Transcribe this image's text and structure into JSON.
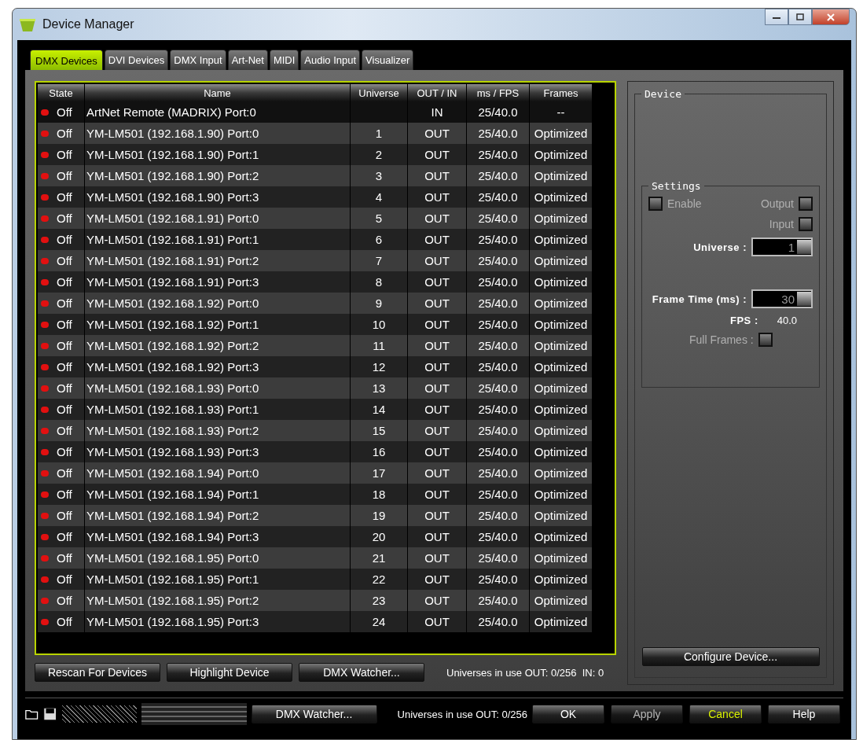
{
  "window": {
    "title": "Device Manager"
  },
  "tabs": [
    {
      "label": "DMX Devices",
      "selected": true
    },
    {
      "label": "DVI Devices",
      "selected": false
    },
    {
      "label": "DMX Input",
      "selected": false
    },
    {
      "label": "Art-Net",
      "selected": false
    },
    {
      "label": "MIDI",
      "selected": false
    },
    {
      "label": "Audio Input",
      "selected": false
    },
    {
      "label": "Visualizer",
      "selected": false
    }
  ],
  "table": {
    "columns": [
      "State",
      "Name",
      "Universe",
      "OUT / IN",
      "ms / FPS",
      "Frames"
    ],
    "rows": [
      {
        "state": "Off",
        "name": "ArtNet Remote (MADRIX) Port:0",
        "universe": "",
        "direction": "IN",
        "rate": "25/40.0",
        "frames": "--"
      },
      {
        "state": "Off",
        "name": "YM-LM501 (192.168.1.90) Port:0",
        "universe": "1",
        "direction": "OUT",
        "rate": "25/40.0",
        "frames": "Optimized"
      },
      {
        "state": "Off",
        "name": "YM-LM501 (192.168.1.90) Port:1",
        "universe": "2",
        "direction": "OUT",
        "rate": "25/40.0",
        "frames": "Optimized"
      },
      {
        "state": "Off",
        "name": "YM-LM501 (192.168.1.90) Port:2",
        "universe": "3",
        "direction": "OUT",
        "rate": "25/40.0",
        "frames": "Optimized"
      },
      {
        "state": "Off",
        "name": "YM-LM501 (192.168.1.90) Port:3",
        "universe": "4",
        "direction": "OUT",
        "rate": "25/40.0",
        "frames": "Optimized"
      },
      {
        "state": "Off",
        "name": "YM-LM501 (192.168.1.91) Port:0",
        "universe": "5",
        "direction": "OUT",
        "rate": "25/40.0",
        "frames": "Optimized"
      },
      {
        "state": "Off",
        "name": "YM-LM501 (192.168.1.91) Port:1",
        "universe": "6",
        "direction": "OUT",
        "rate": "25/40.0",
        "frames": "Optimized"
      },
      {
        "state": "Off",
        "name": "YM-LM501 (192.168.1.91) Port:2",
        "universe": "7",
        "direction": "OUT",
        "rate": "25/40.0",
        "frames": "Optimized"
      },
      {
        "state": "Off",
        "name": "YM-LM501 (192.168.1.91) Port:3",
        "universe": "8",
        "direction": "OUT",
        "rate": "25/40.0",
        "frames": "Optimized"
      },
      {
        "state": "Off",
        "name": "YM-LM501 (192.168.1.92) Port:0",
        "universe": "9",
        "direction": "OUT",
        "rate": "25/40.0",
        "frames": "Optimized"
      },
      {
        "state": "Off",
        "name": "YM-LM501 (192.168.1.92) Port:1",
        "universe": "10",
        "direction": "OUT",
        "rate": "25/40.0",
        "frames": "Optimized"
      },
      {
        "state": "Off",
        "name": "YM-LM501 (192.168.1.92) Port:2",
        "universe": "11",
        "direction": "OUT",
        "rate": "25/40.0",
        "frames": "Optimized"
      },
      {
        "state": "Off",
        "name": "YM-LM501 (192.168.1.92) Port:3",
        "universe": "12",
        "direction": "OUT",
        "rate": "25/40.0",
        "frames": "Optimized"
      },
      {
        "state": "Off",
        "name": "YM-LM501 (192.168.1.93) Port:0",
        "universe": "13",
        "direction": "OUT",
        "rate": "25/40.0",
        "frames": "Optimized"
      },
      {
        "state": "Off",
        "name": "YM-LM501 (192.168.1.93) Port:1",
        "universe": "14",
        "direction": "OUT",
        "rate": "25/40.0",
        "frames": "Optimized"
      },
      {
        "state": "Off",
        "name": "YM-LM501 (192.168.1.93) Port:2",
        "universe": "15",
        "direction": "OUT",
        "rate": "25/40.0",
        "frames": "Optimized"
      },
      {
        "state": "Off",
        "name": "YM-LM501 (192.168.1.93) Port:3",
        "universe": "16",
        "direction": "OUT",
        "rate": "25/40.0",
        "frames": "Optimized"
      },
      {
        "state": "Off",
        "name": "YM-LM501 (192.168.1.94) Port:0",
        "universe": "17",
        "direction": "OUT",
        "rate": "25/40.0",
        "frames": "Optimized"
      },
      {
        "state": "Off",
        "name": "YM-LM501 (192.168.1.94) Port:1",
        "universe": "18",
        "direction": "OUT",
        "rate": "25/40.0",
        "frames": "Optimized"
      },
      {
        "state": "Off",
        "name": "YM-LM501 (192.168.1.94) Port:2",
        "universe": "19",
        "direction": "OUT",
        "rate": "25/40.0",
        "frames": "Optimized"
      },
      {
        "state": "Off",
        "name": "YM-LM501 (192.168.1.94) Port:3",
        "universe": "20",
        "direction": "OUT",
        "rate": "25/40.0",
        "frames": "Optimized"
      },
      {
        "state": "Off",
        "name": "YM-LM501 (192.168.1.95) Port:0",
        "universe": "21",
        "direction": "OUT",
        "rate": "25/40.0",
        "frames": "Optimized"
      },
      {
        "state": "Off",
        "name": "YM-LM501 (192.168.1.95) Port:1",
        "universe": "22",
        "direction": "OUT",
        "rate": "25/40.0",
        "frames": "Optimized"
      },
      {
        "state": "Off",
        "name": "YM-LM501 (192.168.1.95) Port:2",
        "universe": "23",
        "direction": "OUT",
        "rate": "25/40.0",
        "frames": "Optimized"
      },
      {
        "state": "Off",
        "name": "YM-LM501 (192.168.1.95) Port:3",
        "universe": "24",
        "direction": "OUT",
        "rate": "25/40.0",
        "frames": "Optimized"
      }
    ]
  },
  "device_panel": {
    "title": "Device",
    "settings": {
      "title": "Settings",
      "enable": {
        "label": "Enable",
        "checked": false,
        "disabled": true
      },
      "output": {
        "label": "Output",
        "checked": false,
        "disabled": true
      },
      "input": {
        "label": "Input",
        "checked": false,
        "disabled": true
      },
      "universe": {
        "label": "Universe :",
        "value": "1"
      },
      "frame_time": {
        "label": "Frame Time (ms) :",
        "value": "30"
      },
      "fps": {
        "label": "FPS :",
        "value": "40.0"
      },
      "full_frames": {
        "label": "Full Frames :",
        "checked": false,
        "disabled": true
      }
    },
    "configure_button": "Configure Device..."
  },
  "actions": [
    "Rescan For Devices",
    "Highlight Device",
    "DMX Watcher..."
  ],
  "usage": "Universes in use OUT: 0/256  IN: 0",
  "ghost_bar": {
    "watcher": "DMX Watcher...",
    "usage": "Universes in use OUT: 0/256"
  },
  "dialog_buttons": [
    {
      "label": "OK",
      "selected": false,
      "disabled": false
    },
    {
      "label": "Apply",
      "selected": false,
      "disabled": true
    },
    {
      "label": "Cancel",
      "selected": true,
      "disabled": false
    },
    {
      "label": "Help",
      "selected": false,
      "disabled": false
    }
  ]
}
